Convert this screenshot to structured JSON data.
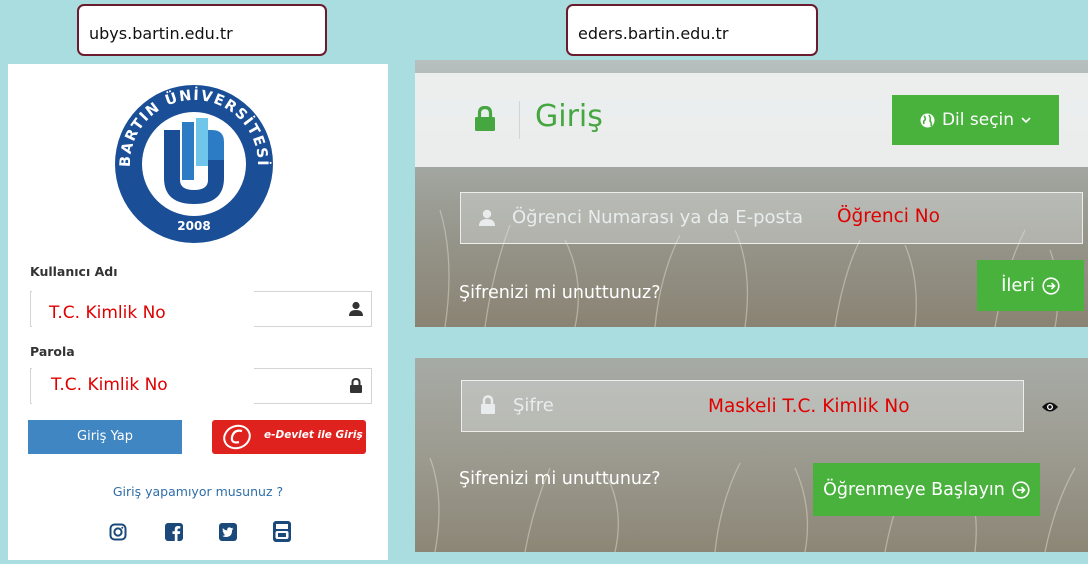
{
  "callouts": {
    "left_url": "ubys.bartin.edu.tr",
    "right_url": "eders.bartin.edu.tr"
  },
  "ubys": {
    "logo": {
      "ring_text": "BARTIN ÜNİVERSİTESİ",
      "year": "2008",
      "colors": {
        "ring": "#1a4e96",
        "mid": "#2b7cc4",
        "light": "#6fc5ea"
      }
    },
    "username_label": "Kullanıcı Adı",
    "username_icon": "user-icon",
    "password_label": "Parola",
    "password_icon": "lock-icon",
    "login_button": "Giriş Yap",
    "edevlet_button": "e-Devlet ile Giriş",
    "forgot_link": "Giriş yapamıyor musunuz ?",
    "social_icons": [
      "instagram-icon",
      "facebook-icon",
      "twitter-icon",
      "youtube-icon"
    ],
    "colors": {
      "login_btn": "#3f86c2",
      "edevlet_btn": "#e0221f",
      "link": "#2f6ea8",
      "social": "#1b4a7a"
    }
  },
  "eders": {
    "header_title": "Giriş",
    "header_icon": "lock-icon",
    "language_button": "Dil seçin",
    "username_placeholder": "Öğrenci Numarası ya da E-posta",
    "forgot_link_1": "Şifrenizi mi unuttunuz?",
    "next_button": "İleri",
    "password_placeholder": "Şifre",
    "forgot_link_2": "Şifrenizi mi unuttunuz?",
    "start_button": "Öğrenmeye Başlayın",
    "colors": {
      "green": "#48b23d",
      "title_green": "#46a640"
    }
  },
  "annotations": {
    "ubys_username": "T.C. Kimlik No",
    "ubys_password": "T.C. Kimlik No",
    "eders_username": "Öğrenci No",
    "eders_password": "Maskeli T.C. Kimlik No",
    "color": "#e00000"
  }
}
